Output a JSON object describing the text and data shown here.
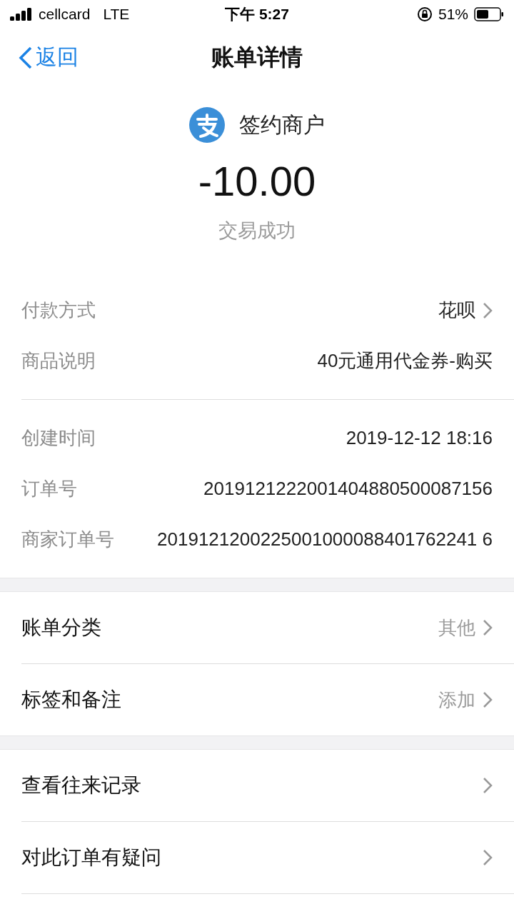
{
  "status_bar": {
    "carrier": "cellcard",
    "network": "LTE",
    "time": "下午 5:27",
    "battery": "51%"
  },
  "nav": {
    "back": "返回",
    "title": "账单详情"
  },
  "merchant": {
    "name": "签约商户",
    "amount": "-10.00",
    "status": "交易成功"
  },
  "detail_groups": [
    [
      {
        "label": "付款方式",
        "value": "花呗",
        "link": true
      },
      {
        "label": "商品说明",
        "value": "40元通用代金券-购买",
        "link": false
      }
    ],
    [
      {
        "label": "创建时间",
        "value": "2019-12-12 18:16",
        "link": false
      },
      {
        "label": "订单号",
        "value": "2019121222001404880500087156",
        "link": false
      },
      {
        "label": "商家订单号",
        "value": "2019121200225001000088401762241 6",
        "link": false
      }
    ]
  ],
  "sections": [
    [
      {
        "label": "账单分类",
        "value": "其他",
        "link": true
      },
      {
        "label": "标签和备注",
        "value": "添加",
        "link": true
      }
    ],
    [
      {
        "label": "查看往来记录",
        "link": true
      },
      {
        "label": "对此订单有疑问",
        "link": true
      }
    ]
  ]
}
